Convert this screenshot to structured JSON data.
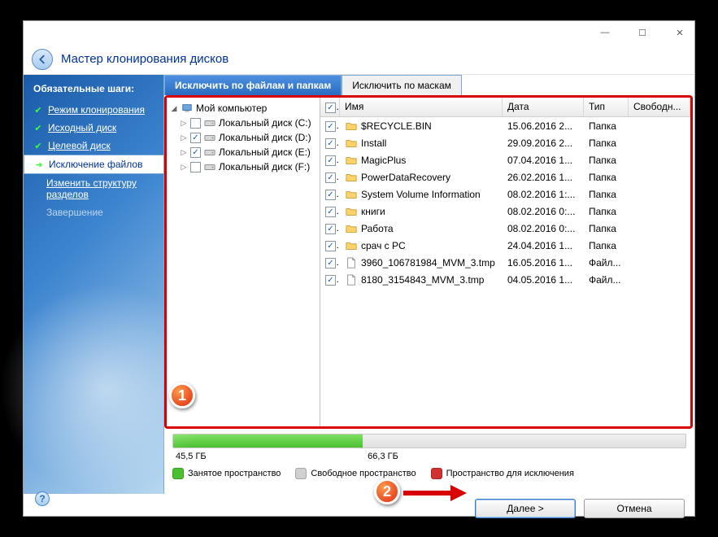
{
  "window": {
    "title": "Мастер клонирования дисков"
  },
  "sidebar": {
    "header": "Обязательные шаги:",
    "items": [
      {
        "label": "Режим клонирования",
        "state": "done"
      },
      {
        "label": "Исходный диск",
        "state": "done"
      },
      {
        "label": "Целевой диск",
        "state": "done"
      },
      {
        "label": "Исключение файлов",
        "state": "active"
      },
      {
        "label": "Изменить структуру разделов",
        "state": "sub"
      },
      {
        "label": "Завершение",
        "state": "muted"
      }
    ]
  },
  "tabs": {
    "files": "Исключить по файлам и папкам",
    "masks": "Исключить по маскам"
  },
  "tree": {
    "root": "Мой компьютер",
    "drives": [
      {
        "label": "Локальный диск (C:)",
        "checked": false
      },
      {
        "label": "Локальный диск (D:)",
        "checked": true
      },
      {
        "label": "Локальный диск (E:)",
        "checked": true
      },
      {
        "label": "Локальный диск (F:)",
        "checked": false
      }
    ]
  },
  "list": {
    "headers": {
      "name": "Имя",
      "date": "Дата",
      "type": "Тип",
      "free": "Свободн..."
    },
    "rows": [
      {
        "name": "$RECYCLE.BIN",
        "date": "15.06.2016 2...",
        "type": "Папка",
        "icon": "folder",
        "checked": true
      },
      {
        "name": "Install",
        "date": "29.09.2016 2...",
        "type": "Папка",
        "icon": "folder",
        "checked": true
      },
      {
        "name": "MagicPlus",
        "date": "07.04.2016 1...",
        "type": "Папка",
        "icon": "folder",
        "checked": true
      },
      {
        "name": "PowerDataRecovery",
        "date": "26.02.2016 1...",
        "type": "Папка",
        "icon": "folder",
        "checked": true
      },
      {
        "name": "System Volume Information",
        "date": "08.02.2016 1:...",
        "type": "Папка",
        "icon": "folder",
        "checked": true
      },
      {
        "name": "книги",
        "date": "08.02.2016 0:...",
        "type": "Папка",
        "icon": "folder",
        "checked": true
      },
      {
        "name": "Работа",
        "date": "08.02.2016 0:...",
        "type": "Папка",
        "icon": "folder",
        "checked": true
      },
      {
        "name": "срач с PC",
        "date": "24.04.2016 1...",
        "type": "Папка",
        "icon": "folder",
        "checked": true
      },
      {
        "name": "3960_106781984_MVM_3.tmp",
        "date": "16.05.2016 1...",
        "type": "Файл...",
        "icon": "file",
        "checked": true
      },
      {
        "name": "8180_3154843_MVM_3.tmp",
        "date": "04.05.2016 1...",
        "type": "Файл...",
        "icon": "file",
        "checked": true
      }
    ]
  },
  "progress": {
    "used_label": "45,5 ГБ",
    "total_label": "66,3 ГБ",
    "used_percent": 37
  },
  "legend": {
    "used": "Занятое пространство",
    "free": "Свободное пространство",
    "excluded": "Пространство для исключения"
  },
  "buttons": {
    "next": "Далее >",
    "cancel": "Отмена"
  },
  "callouts": {
    "one": "1",
    "two": "2"
  }
}
